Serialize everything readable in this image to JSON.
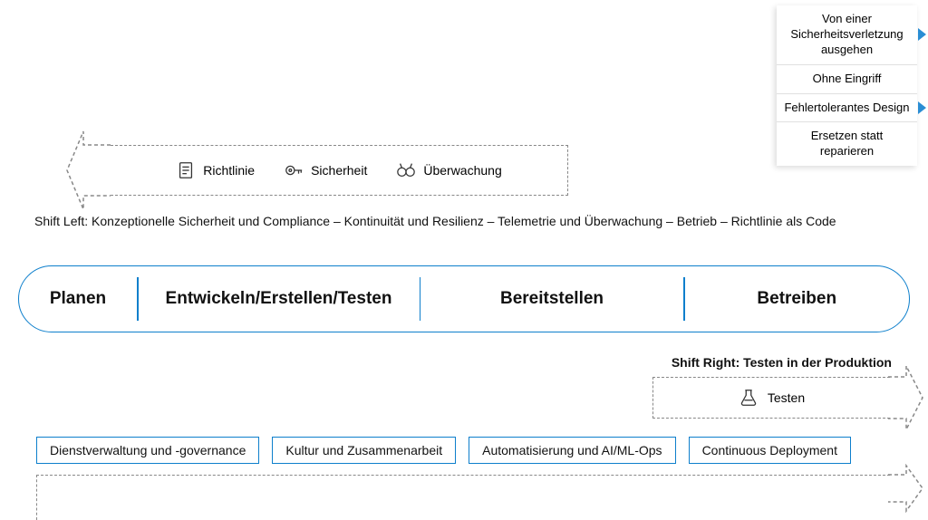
{
  "callout": {
    "items": [
      "Von einer Sicherheitsverletzung ausgehen",
      "Ohne Eingriff",
      "Fehlertolerantes Design",
      "Ersetzen statt reparieren"
    ]
  },
  "shift_left_arrow": {
    "items": [
      {
        "icon": "policy-icon",
        "label": "Richtlinie"
      },
      {
        "icon": "security-icon",
        "label": "Sicherheit"
      },
      {
        "icon": "monitoring-icon",
        "label": "Überwachung"
      }
    ]
  },
  "shift_left_text": "Shift Left: Konzeptionelle Sicherheit und Compliance – Kontinuität und Resilienz – Telemetrie und Überwachung – Betrieb – Richtlinie als Code",
  "pill": {
    "sections": [
      "Planen",
      "Entwickeln/Erstellen/Testen",
      "Bereitstellen",
      "Betreiben"
    ]
  },
  "shift_right_text": "Shift Right: Testen in der Produktion",
  "shift_right_arrow": {
    "icon": "test-icon",
    "label": "Testen"
  },
  "bottom_boxes": [
    "Dienstverwaltung und -governance",
    "Kultur und Zusammenarbeit",
    "Automatisierung und AI/ML-Ops",
    "Continuous Deployment"
  ]
}
